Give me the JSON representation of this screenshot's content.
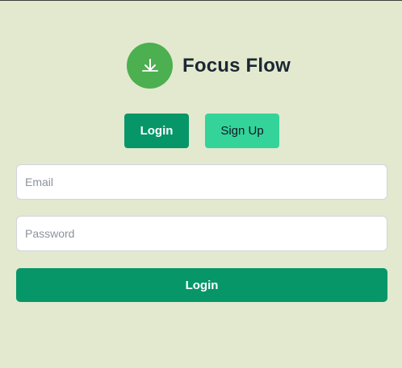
{
  "brand": {
    "logo_icon": "check-arrow-icon",
    "title": "Focus Flow"
  },
  "auth_toggle": {
    "login_label": "Login",
    "signup_label": "Sign Up",
    "active": "Login"
  },
  "form": {
    "email_placeholder": "Email",
    "email_value": "",
    "password_placeholder": "Password",
    "password_value": "",
    "submit_label": "Login"
  },
  "colors": {
    "background": "#e2e9cf",
    "primary": "#069668",
    "secondary": "#34d399",
    "logo": "#4caf50",
    "title_text": "#1c2733"
  }
}
